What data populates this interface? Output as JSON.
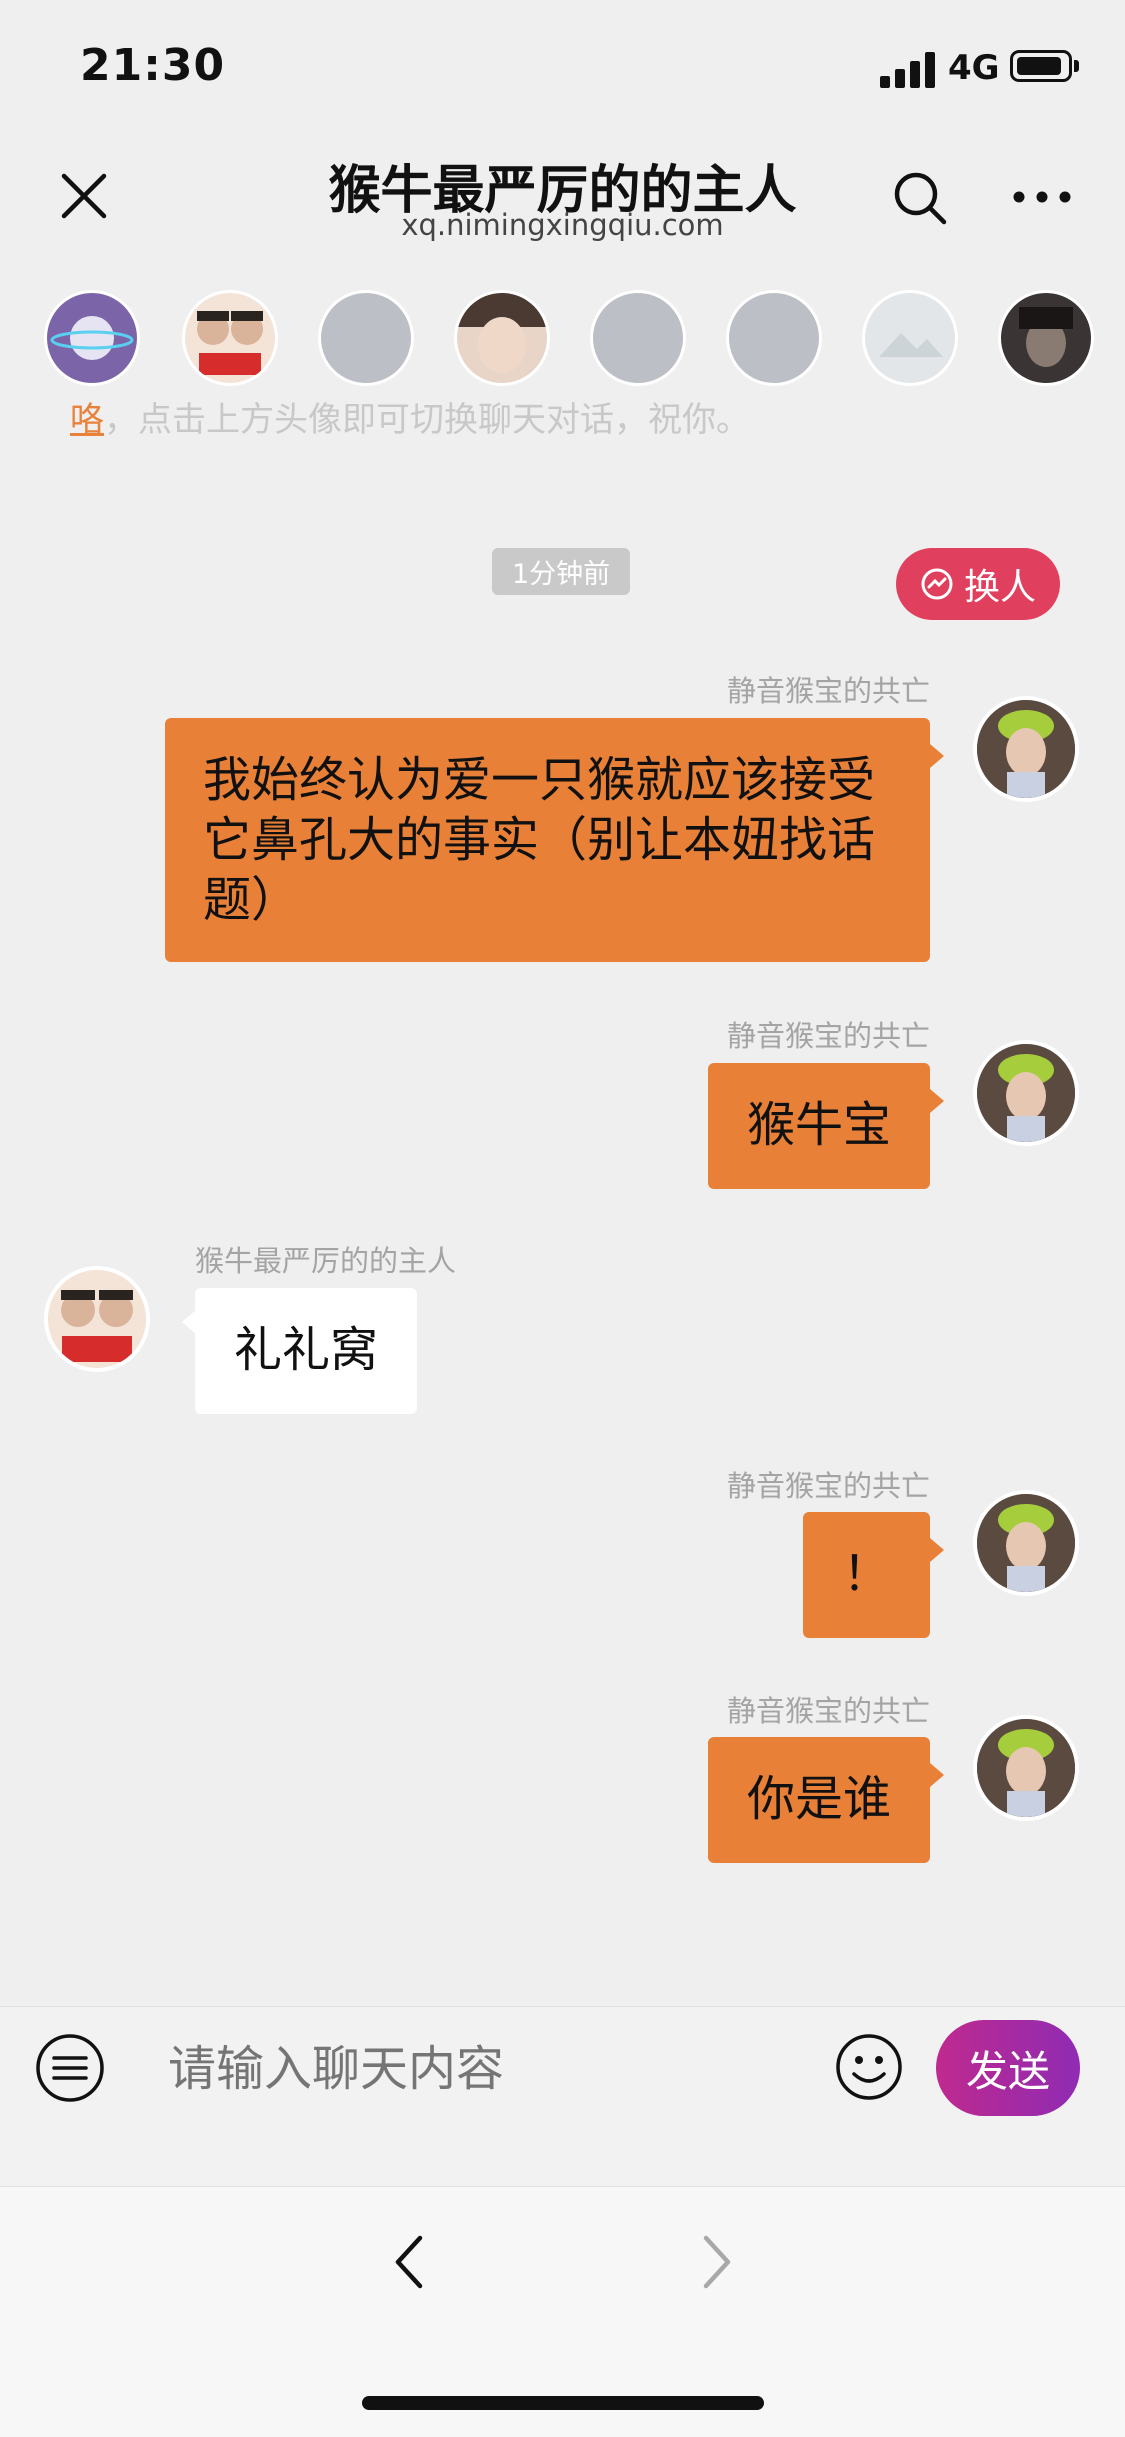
{
  "status": {
    "time": "21:30",
    "network": "4G"
  },
  "header": {
    "title": "猴牛最严厉的的主人",
    "subtitle": "xq.nimingxingqiu.com"
  },
  "notice": {
    "link": "咯",
    "text": "，点击上方头像即可切换聊天对话，祝你。"
  },
  "chat": {
    "time_badge": "1分钟前",
    "switch_label": "换人",
    "messages": [
      {
        "sender": "静音猴宝的共亡",
        "text": "我始终认为爱一只猴就应该接受它鼻孔大的事实（别让本妞找话题）",
        "side": "right"
      },
      {
        "sender": "静音猴宝的共亡",
        "text": "猴牛宝",
        "side": "right"
      },
      {
        "sender": "猴牛最严厉的的主人",
        "text": "礼礼窝",
        "side": "left"
      },
      {
        "sender": "静音猴宝的共亡",
        "text": "！",
        "side": "right"
      },
      {
        "sender": "静音猴宝的共亡",
        "text": "你是谁",
        "side": "right"
      }
    ]
  },
  "input": {
    "placeholder": "请输入聊天内容",
    "send_label": "发送"
  },
  "colors": {
    "accent": "#e88137",
    "switch": "#e13f5e",
    "send_start": "#bf2a8e",
    "send_end": "#8f2bb3"
  },
  "icons": [
    "close-icon",
    "search-icon",
    "more-icon",
    "menu-icon",
    "emoji-icon",
    "back-arrow-icon",
    "forward-arrow-icon"
  ]
}
